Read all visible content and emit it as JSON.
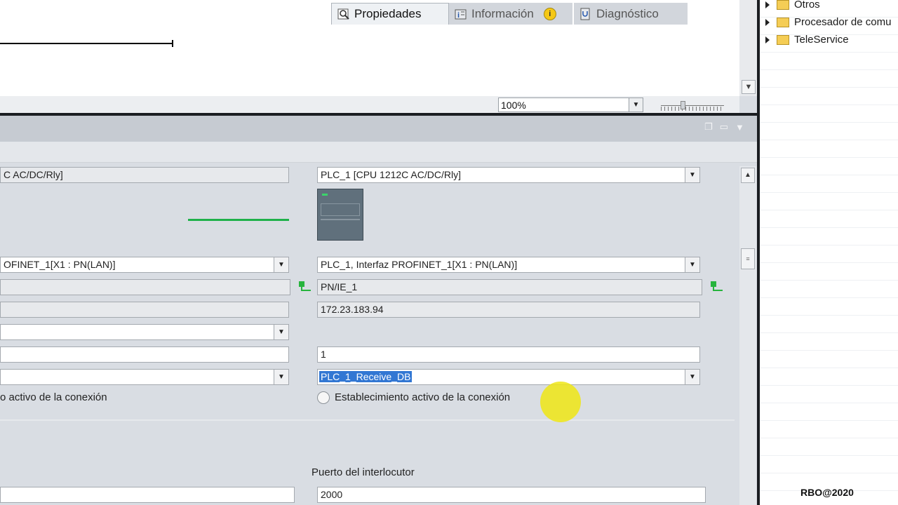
{
  "editor": {
    "zoom_value": "100%"
  },
  "inspector": {
    "tabs": [
      {
        "label": "Propiedades",
        "icon": "properties-icon",
        "active": true
      },
      {
        "label": "Información",
        "icon": "info-tab-icon",
        "badge": "i"
      },
      {
        "label": "Diagnóstico",
        "icon": "diagnostics-icon"
      }
    ]
  },
  "local": {
    "endpoint": "C AC/DC/Rly]",
    "interface": "OFINET_1[X1 : PN(LAN)]",
    "subnet": "",
    "address": "",
    "connection_type": "",
    "connection_id": "",
    "data_block": "",
    "active_establishment": "o activo de la conexión",
    "port": ""
  },
  "partner": {
    "endpoint": "PLC_1 [CPU 1212C AC/DC/Rly]",
    "interface": "PLC_1, Interfaz PROFINET_1[X1 : PN(LAN)]",
    "subnet": "PN/IE_1",
    "address": "172.23.183.94",
    "connection_id": "1",
    "data_block": "PLC_1_Receive_DB",
    "active_establishment": "Establecimiento activo de la conexión",
    "port_label": "Puerto del interlocutor",
    "port": "2000"
  },
  "tree": {
    "items": [
      "Otros",
      "Procesador de comu",
      "TeleService"
    ]
  },
  "watermark": "RBO@2020"
}
